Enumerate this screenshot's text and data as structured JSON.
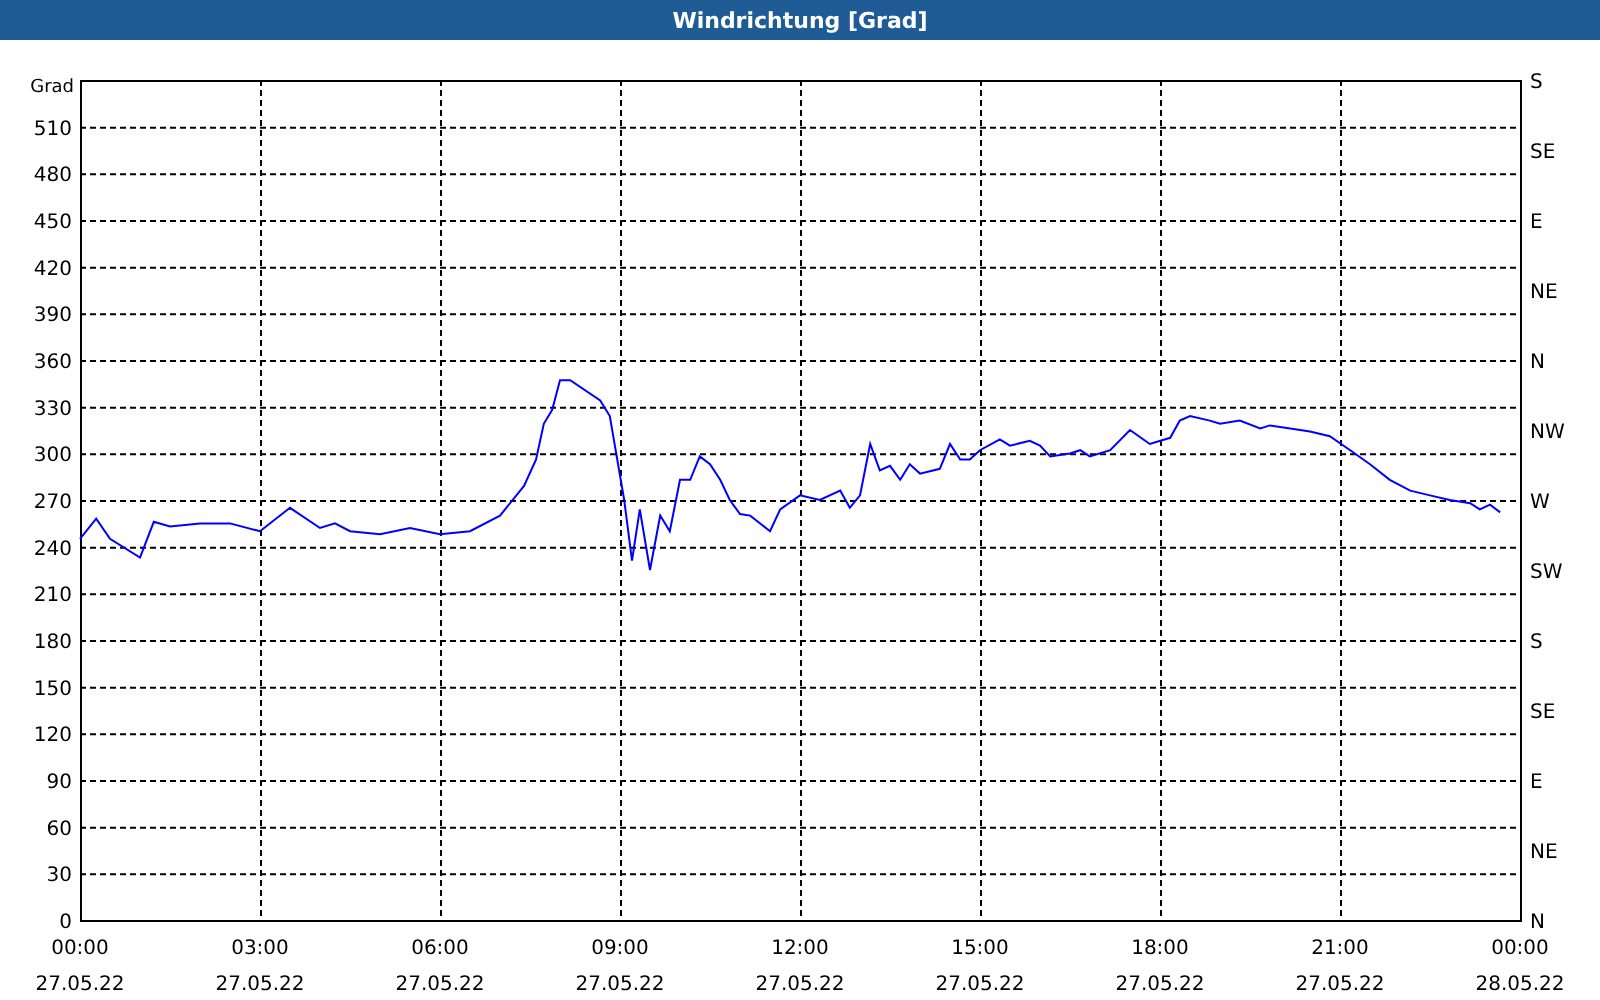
{
  "window": {
    "title": "Windrichtung [Grad]"
  },
  "chart": {
    "chart_data": {
      "type": "line",
      "grid": true,
      "ylabel": "Grad",
      "xlim": [
        0,
        24
      ],
      "ylim": [
        0,
        540
      ],
      "xticks": [
        {
          "value": 0,
          "label": "00:00"
        },
        {
          "value": 3,
          "label": "03:00"
        },
        {
          "value": 6,
          "label": "06:00"
        },
        {
          "value": 9,
          "label": "09:00"
        },
        {
          "value": 12,
          "label": "12:00"
        },
        {
          "value": 15,
          "label": "15:00"
        },
        {
          "value": 18,
          "label": "18:00"
        },
        {
          "value": 21,
          "label": "21:00"
        },
        {
          "value": 24,
          "label": "00:00"
        }
      ],
      "yticks": [
        0,
        30,
        60,
        90,
        120,
        150,
        180,
        210,
        240,
        270,
        300,
        330,
        360,
        390,
        420,
        450,
        480,
        510
      ],
      "x": [
        0,
        0.27,
        0.5,
        1,
        1.23,
        1.5,
        2,
        2.5,
        3,
        3.5,
        4,
        4.25,
        4.5,
        5,
        5.5,
        6,
        6.5,
        7,
        7.4,
        7.6,
        7.73,
        7.87,
        8,
        8.17,
        8.67,
        8.83,
        9.07,
        9.2,
        9.33,
        9.5,
        9.67,
        9.83,
        10,
        10.17,
        10.33,
        10.5,
        10.67,
        10.83,
        11,
        11.17,
        11.5,
        11.67,
        12,
        12.33,
        12.67,
        12.83,
        13,
        13.17,
        13.33,
        13.5,
        13.67,
        13.83,
        14,
        14.33,
        14.5,
        14.67,
        14.83,
        15,
        15.33,
        15.5,
        15.83,
        16,
        16.17,
        16.5,
        16.67,
        16.83,
        17.17,
        17.5,
        17.83,
        18.17,
        18.33,
        18.5,
        18.83,
        19,
        19.33,
        19.67,
        19.83,
        20.17,
        20.5,
        20.83,
        21.17,
        21.5,
        21.83,
        22.17,
        22.5,
        22.83,
        23.17,
        23.33,
        23.5,
        23.67
      ],
      "series": [
        {
          "color": "#0000ff",
          "values": [
            245,
            258,
            245,
            233,
            256,
            253,
            255,
            255,
            250,
            265,
            252,
            255,
            250,
            248,
            252,
            248,
            250,
            260,
            279,
            296,
            319,
            328,
            347,
            347,
            334,
            324,
            270,
            231,
            264,
            225,
            260,
            250,
            283,
            283,
            298,
            293,
            283,
            270,
            261,
            260,
            250,
            264,
            273,
            270,
            276,
            265,
            273,
            306,
            289,
            292,
            283,
            293,
            287,
            290,
            306,
            296,
            296,
            302,
            309,
            305,
            308,
            305,
            298,
            300,
            302,
            298,
            302,
            315,
            306,
            310,
            321,
            324,
            321,
            319,
            321,
            316,
            318,
            316,
            314,
            311,
            302,
            293,
            283,
            276,
            273,
            270,
            268,
            264,
            267,
            262
          ]
        }
      ]
    },
    "date_labels": [
      "27.05.22",
      "27.05.22",
      "27.05.22",
      "27.05.22",
      "27.05.22",
      "27.05.22",
      "27.05.22",
      "27.05.22",
      "28.05.22"
    ],
    "right_axis": {
      "labels": [
        "S",
        "SE",
        "E",
        "NE",
        "N",
        "NW",
        "W",
        "SW",
        "S",
        "SE",
        "E",
        "NE",
        "N"
      ]
    }
  }
}
